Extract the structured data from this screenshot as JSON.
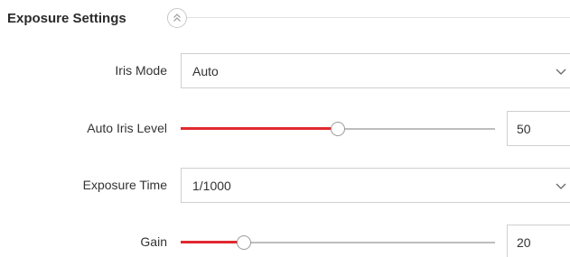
{
  "section": {
    "title": "Exposure Settings",
    "collapse_icon": "double-chevron-up-icon"
  },
  "iris_mode": {
    "label": "Iris Mode",
    "selected": "Auto",
    "chevron_icon": "chevron-down-icon"
  },
  "auto_iris_level": {
    "label": "Auto Iris Level",
    "value": "50",
    "min": 0,
    "max": 100,
    "fill_color": "#e0292f"
  },
  "exposure_time": {
    "label": "Exposure Time",
    "selected": "1/1000",
    "chevron_icon": "chevron-down-icon"
  },
  "gain": {
    "label": "Gain",
    "value": "20",
    "min": 0,
    "max": 100,
    "fill_color": "#e0292f"
  }
}
